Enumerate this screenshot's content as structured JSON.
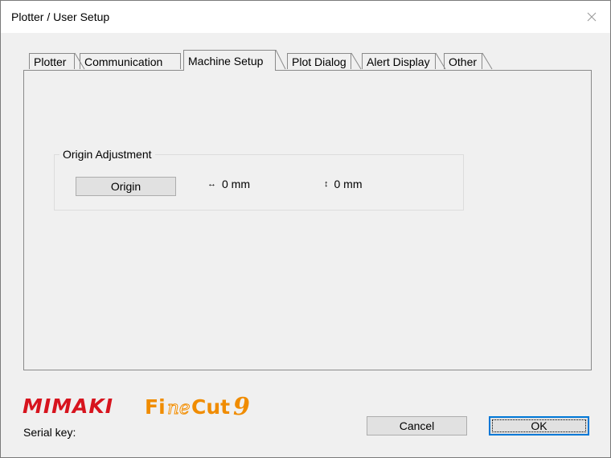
{
  "window": {
    "title": "Plotter / User Setup",
    "close_icon": "close-icon"
  },
  "tabs": [
    {
      "label": "Plotter",
      "active": false
    },
    {
      "label": "Communication",
      "active": false
    },
    {
      "label": "Machine Setup",
      "active": true
    },
    {
      "label": "Plot Dialog",
      "active": false
    },
    {
      "label": "Alert Display",
      "active": false
    },
    {
      "label": "Other",
      "active": false
    }
  ],
  "origin_adjustment": {
    "title": "Origin Adjustment",
    "origin_button": "Origin",
    "horizontal": {
      "icon": "horizontal-arrow-icon",
      "value": "0 mm"
    },
    "vertical": {
      "icon": "vertical-arrow-icon",
      "value": "0 mm"
    }
  },
  "footer": {
    "logo_text": "MIMAKI FineCut 9",
    "serial_label": "Serial key:",
    "cancel_label": "Cancel",
    "ok_label": "OK"
  },
  "colors": {
    "mimaki_red": "#d7141e",
    "finecut_orange": "#f08c00",
    "focus_blue": "#0078d7"
  }
}
